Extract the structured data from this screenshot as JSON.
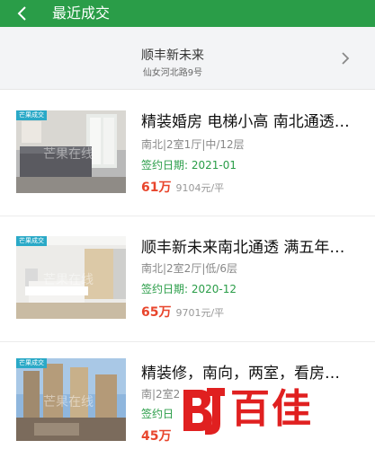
{
  "header": {
    "title": "最近成交",
    "back_icon": "chevron-left-icon"
  },
  "community": {
    "name": "顺丰新未来",
    "address": "仙女河北路9号",
    "chevron_icon": "chevron-right-icon"
  },
  "listings": [
    {
      "badge": "芒果成交",
      "watermark": "芒果在线",
      "title": "精装婚房 电梯小高 南北通透…",
      "meta": "南北|2室1厅|中/12层",
      "sign_date": "签约日期: 2021-01",
      "price": "61万",
      "unit_price": "9104元/平"
    },
    {
      "badge": "芒果成交",
      "watermark": "芒果在线",
      "title": "顺丰新未来南北通透  满五年…",
      "meta": "南北|2室2厅|低/6层",
      "sign_date": "签约日期: 2020-12",
      "price": "65万",
      "unit_price": "9701元/平"
    },
    {
      "badge": "芒果成交",
      "watermark": "芒果在线",
      "title": "精装修，南向，两室，看房…",
      "meta": "南|2室2",
      "sign_date": "签约日",
      "price": "45万",
      "unit_price": ""
    }
  ],
  "brand": {
    "text": "百佳",
    "logo_icon": "bj-logo-icon"
  },
  "colors": {
    "header_green": "#2a9d48",
    "price_red": "#e8452c",
    "badge_blue": "#2aa9c7",
    "brand_red": "#e02020"
  }
}
